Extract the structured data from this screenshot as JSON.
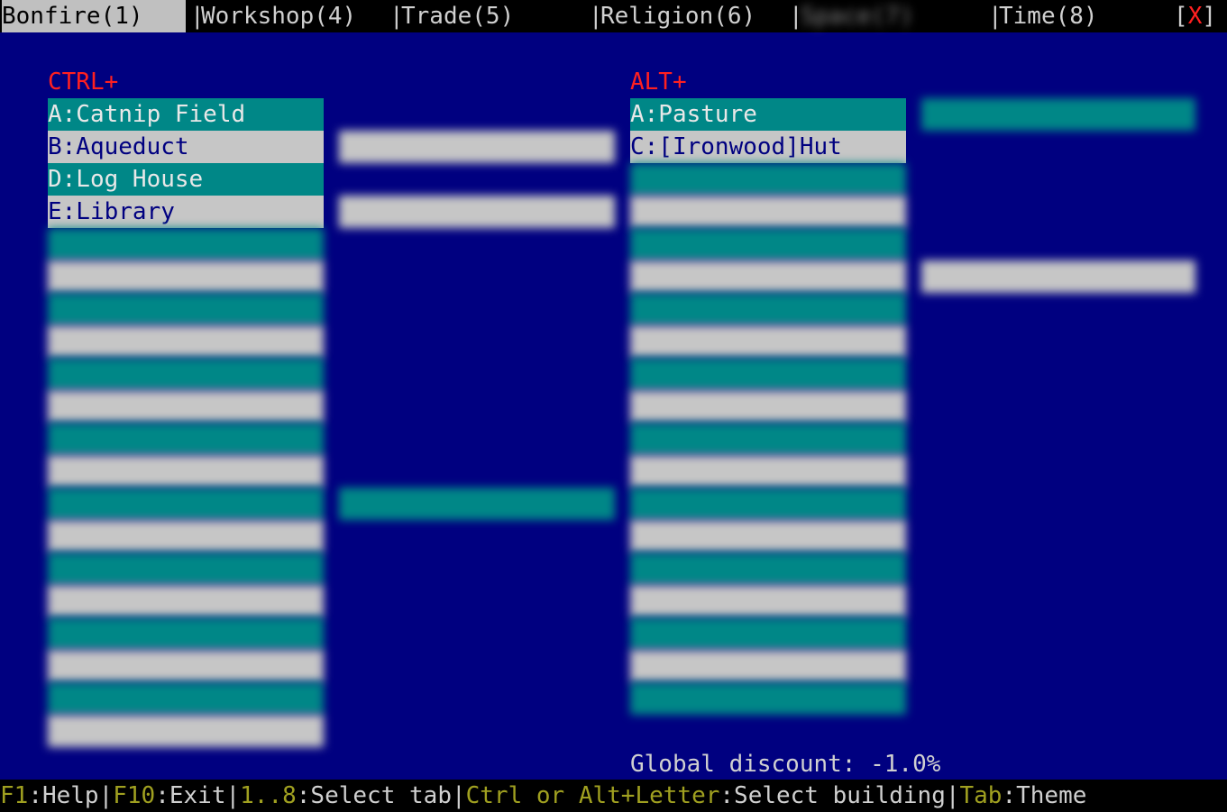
{
  "topbar": {
    "tabs": [
      {
        "label": "Bonfire(1)",
        "active": true
      },
      {
        "label": "Workshop(4)"
      },
      {
        "label": "Trade(5)"
      },
      {
        "label": "Religion(6)"
      },
      {
        "label": "Space(7)",
        "obscured": true
      },
      {
        "label": "Time(8)"
      }
    ],
    "close": {
      "open": "[",
      "x": "X",
      "close": "]"
    }
  },
  "ctrl": {
    "header": "CTRL+",
    "visible_items": [
      {
        "label": "A:Catnip Field",
        "style": "teal"
      },
      {
        "label": "B:Aqueduct",
        "style": "grey"
      },
      {
        "label": "D:Log House",
        "style": "teal"
      },
      {
        "label": "E:Library",
        "style": "grey"
      }
    ]
  },
  "alt": {
    "header": "ALT+",
    "visible_items": [
      {
        "label": "A:Pasture",
        "style": "teal"
      },
      {
        "label": "C:[Ironwood]Hut",
        "style": "grey"
      }
    ]
  },
  "footer": {
    "discount": "Global discount: -1.0%",
    "hints": [
      {
        "key": "F1",
        "desc": ":Help"
      },
      {
        "key": "F10",
        "desc": ":Exit"
      },
      {
        "key": "1..8",
        "desc": ":Select tab"
      },
      {
        "key": "Ctrl or Alt+Letter",
        "desc": ":Select building"
      },
      {
        "key": "Tab",
        "desc": ":Theme"
      }
    ]
  },
  "colors": {
    "background": "#000080",
    "teal": "#008787",
    "grey": "#c6c6c6",
    "header_red": "#ff2020",
    "hint_key": "#a0a020"
  }
}
